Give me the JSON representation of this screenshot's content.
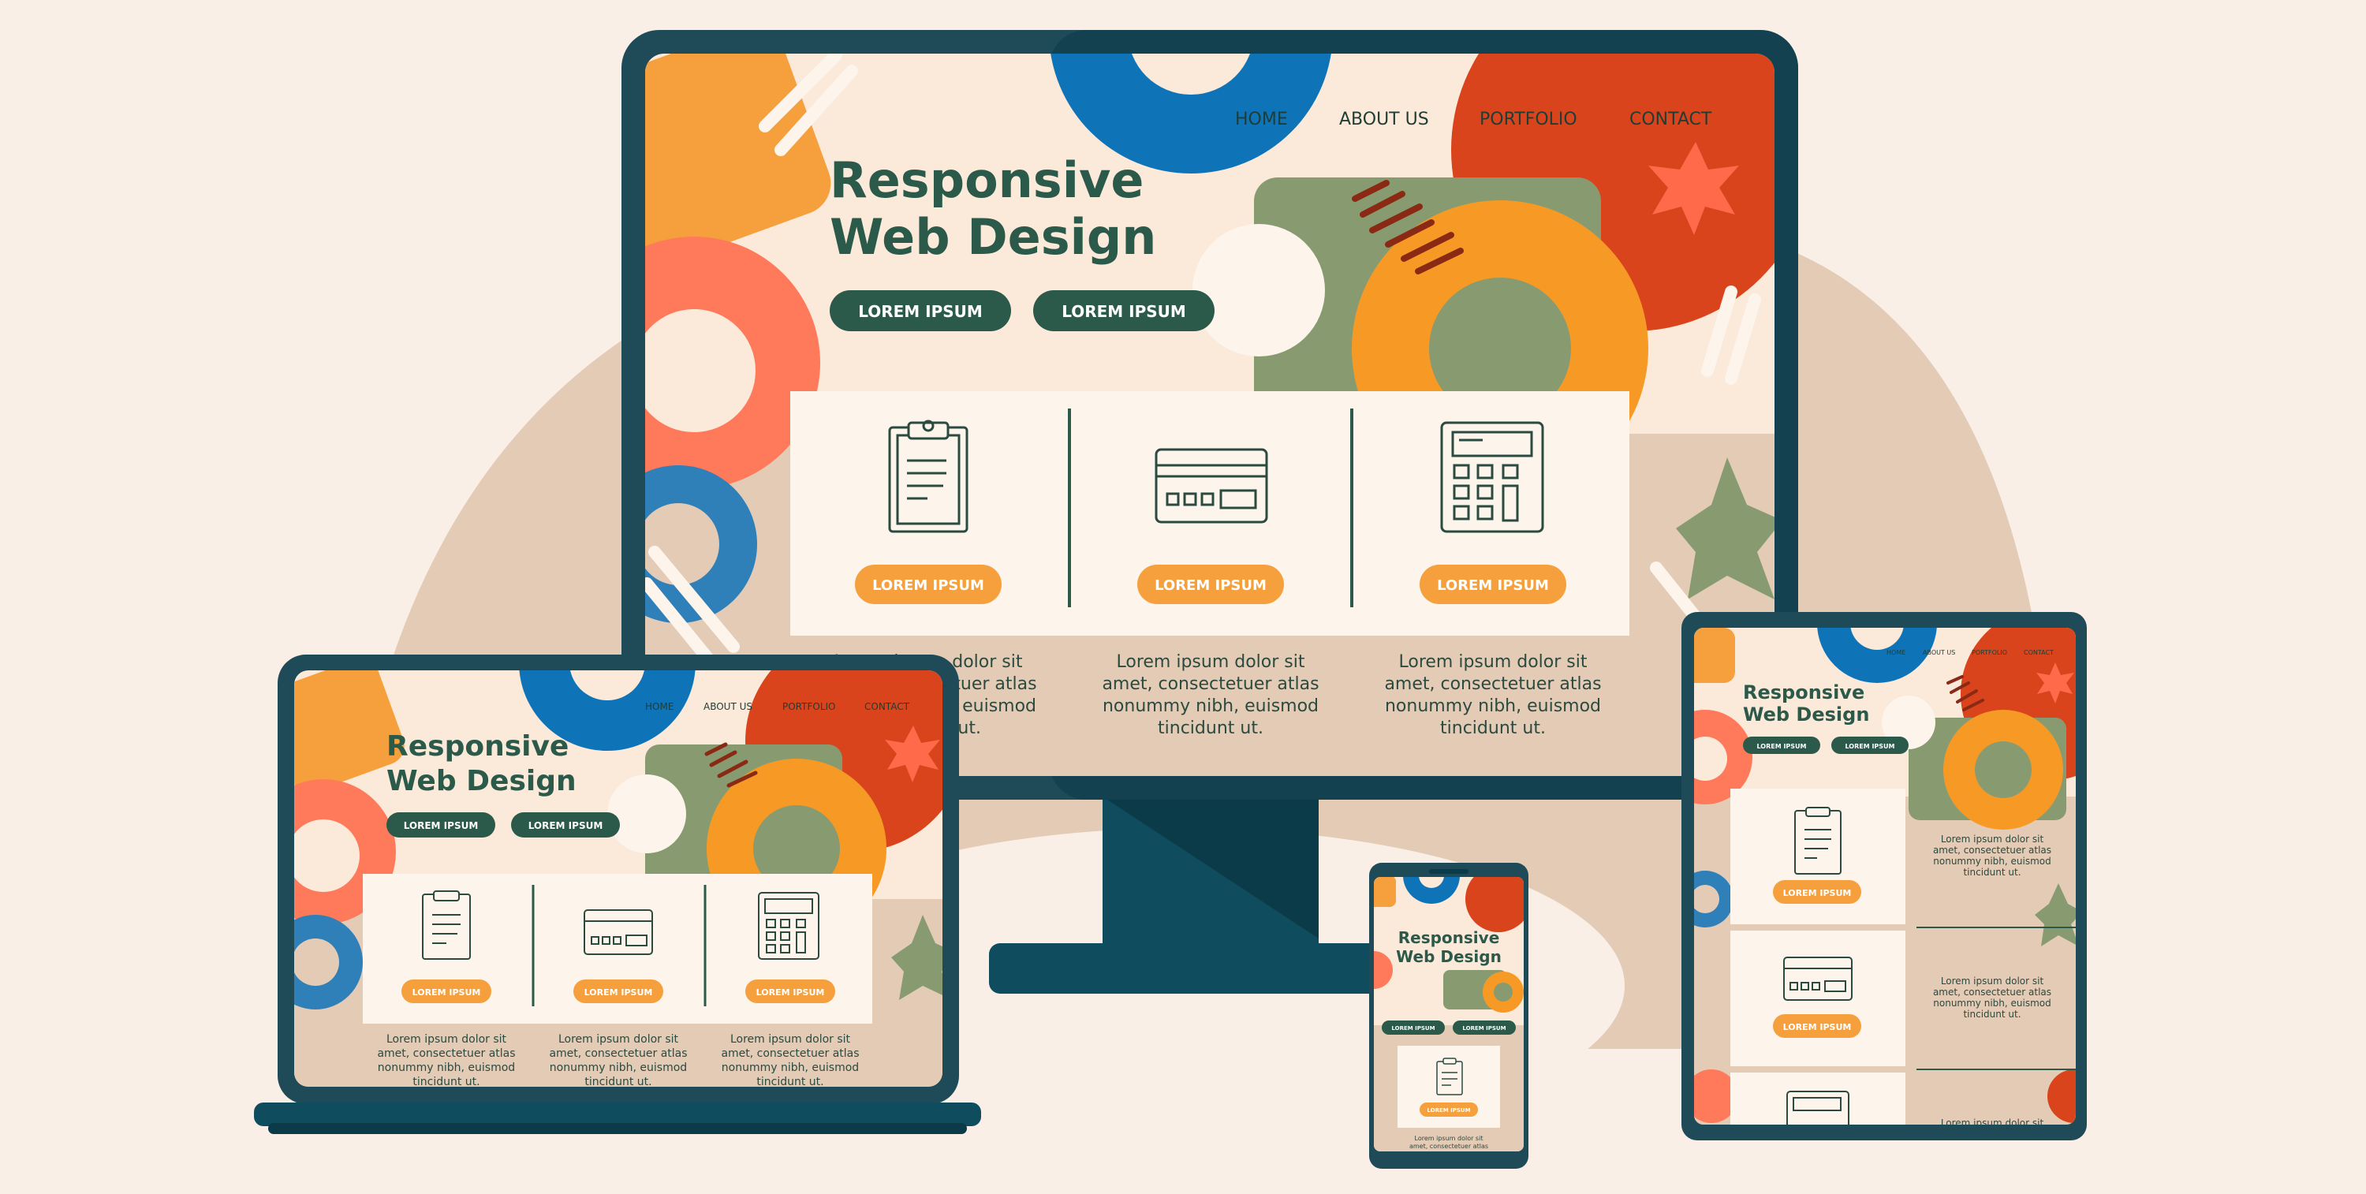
{
  "nav": {
    "home": "HOME",
    "about": "ABOUT US",
    "portfolio": "PORTFOLIO",
    "contact": "CONTACT"
  },
  "hero": {
    "title_line1": "Responsive",
    "title_line2": "Web Design",
    "button_primary": "LOREM IPSUM",
    "button_secondary": "LOREM IPSUM"
  },
  "features": [
    {
      "icon": "clipboard-icon",
      "button": "LOREM IPSUM",
      "text_line1": "Lorem ipsum dolor sit",
      "text_line2": "amet, consectetuer atlas",
      "text_line3": "nonummy nibh, euismod",
      "text_line4": "tincidunt ut."
    },
    {
      "icon": "credit-card-icon",
      "button": "LOREM IPSUM",
      "text_line1": "Lorem ipsum dolor sit",
      "text_line2": "amet, consectetuer atlas",
      "text_line3": "nonummy nibh, euismod",
      "text_line4": "tincidunt ut."
    },
    {
      "icon": "calculator-icon",
      "button": "LOREM IPSUM",
      "text_line1": "Lorem ipsum dolor sit",
      "text_line2": "amet, consectetuer atlas",
      "text_line3": "nonummy nibh, euismod",
      "text_line4": "tincidunt ut."
    }
  ],
  "colors": {
    "background": "#f9efe6",
    "device_frame": "#1f4a57",
    "dark_green": "#2b5a4a",
    "orange": "#f5a03c",
    "red_orange": "#d9441c",
    "coral": "#ff7a5a",
    "blue": "#0f73b8",
    "sage": "#889b70",
    "tan": "#e3cbb6",
    "cream": "#fdf4ec"
  }
}
